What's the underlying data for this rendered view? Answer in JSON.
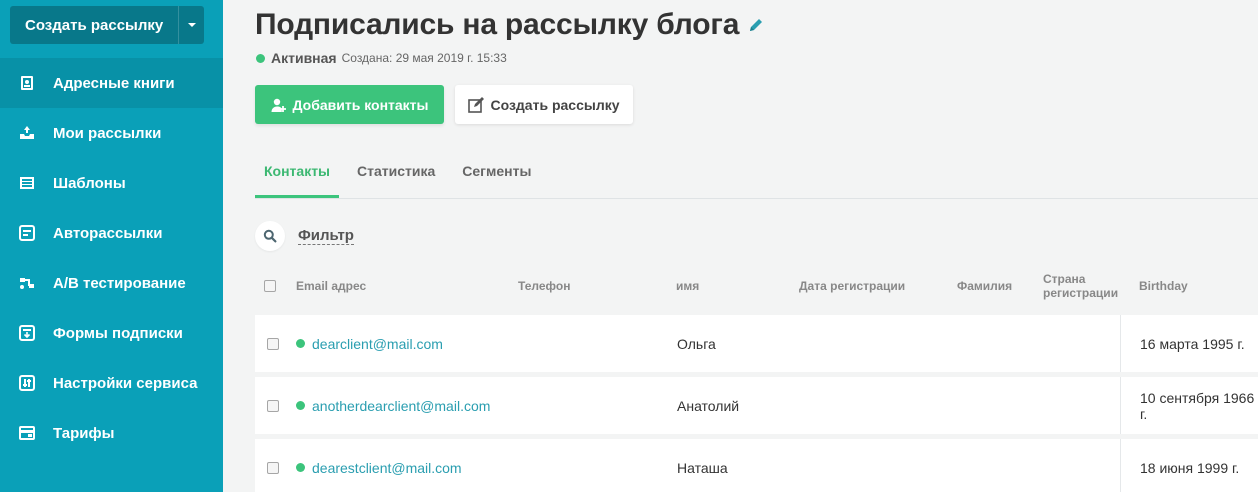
{
  "sidebar": {
    "create_button": "Создать рассылку",
    "items": [
      {
        "label": "Адресные книги",
        "icon": "address-book-icon"
      },
      {
        "label": "Мои рассылки",
        "icon": "campaigns-icon"
      },
      {
        "label": "Шаблоны",
        "icon": "templates-icon"
      },
      {
        "label": "Авторассылки",
        "icon": "automation-icon"
      },
      {
        "label": "A/B тестирование",
        "icon": "ab-test-icon"
      },
      {
        "label": "Формы подписки",
        "icon": "forms-icon"
      },
      {
        "label": "Настройки сервиса",
        "icon": "settings-icon"
      },
      {
        "label": "Тарифы",
        "icon": "pricing-icon"
      }
    ]
  },
  "header": {
    "title": "Подписались на рассылку блога",
    "status": "Активная",
    "created": "Создана: 29 мая 2019 г. 15:33"
  },
  "actions": {
    "add_contacts": "Добавить контакты",
    "create_campaign": "Создать рассылку"
  },
  "tabs": [
    {
      "label": "Контакты",
      "active": true
    },
    {
      "label": "Статистика",
      "active": false
    },
    {
      "label": "Сегменты",
      "active": false
    }
  ],
  "filter": {
    "label": "Фильтр"
  },
  "table": {
    "columns": {
      "email": "Email адрес",
      "phone": "Телефон",
      "name": "имя",
      "reg_date": "Дата регистрации",
      "surname": "Фамилия",
      "country": "Страна регистрации",
      "birthday": "Birthday"
    },
    "rows": [
      {
        "email": "dearclient@mail.com",
        "name": "Ольга",
        "birthday": "16 марта 1995 г."
      },
      {
        "email": "anotherdearclient@mail.com",
        "name": "Анатолий",
        "birthday": "10 сентября 1966 г."
      },
      {
        "email": "dearestclient@mail.com",
        "name": "Наташа",
        "birthday": "18 июня 1999 г."
      }
    ]
  },
  "colors": {
    "sidebar": "#0aa0b8",
    "accent_green": "#3cc47c",
    "link": "#2a9eb0"
  }
}
